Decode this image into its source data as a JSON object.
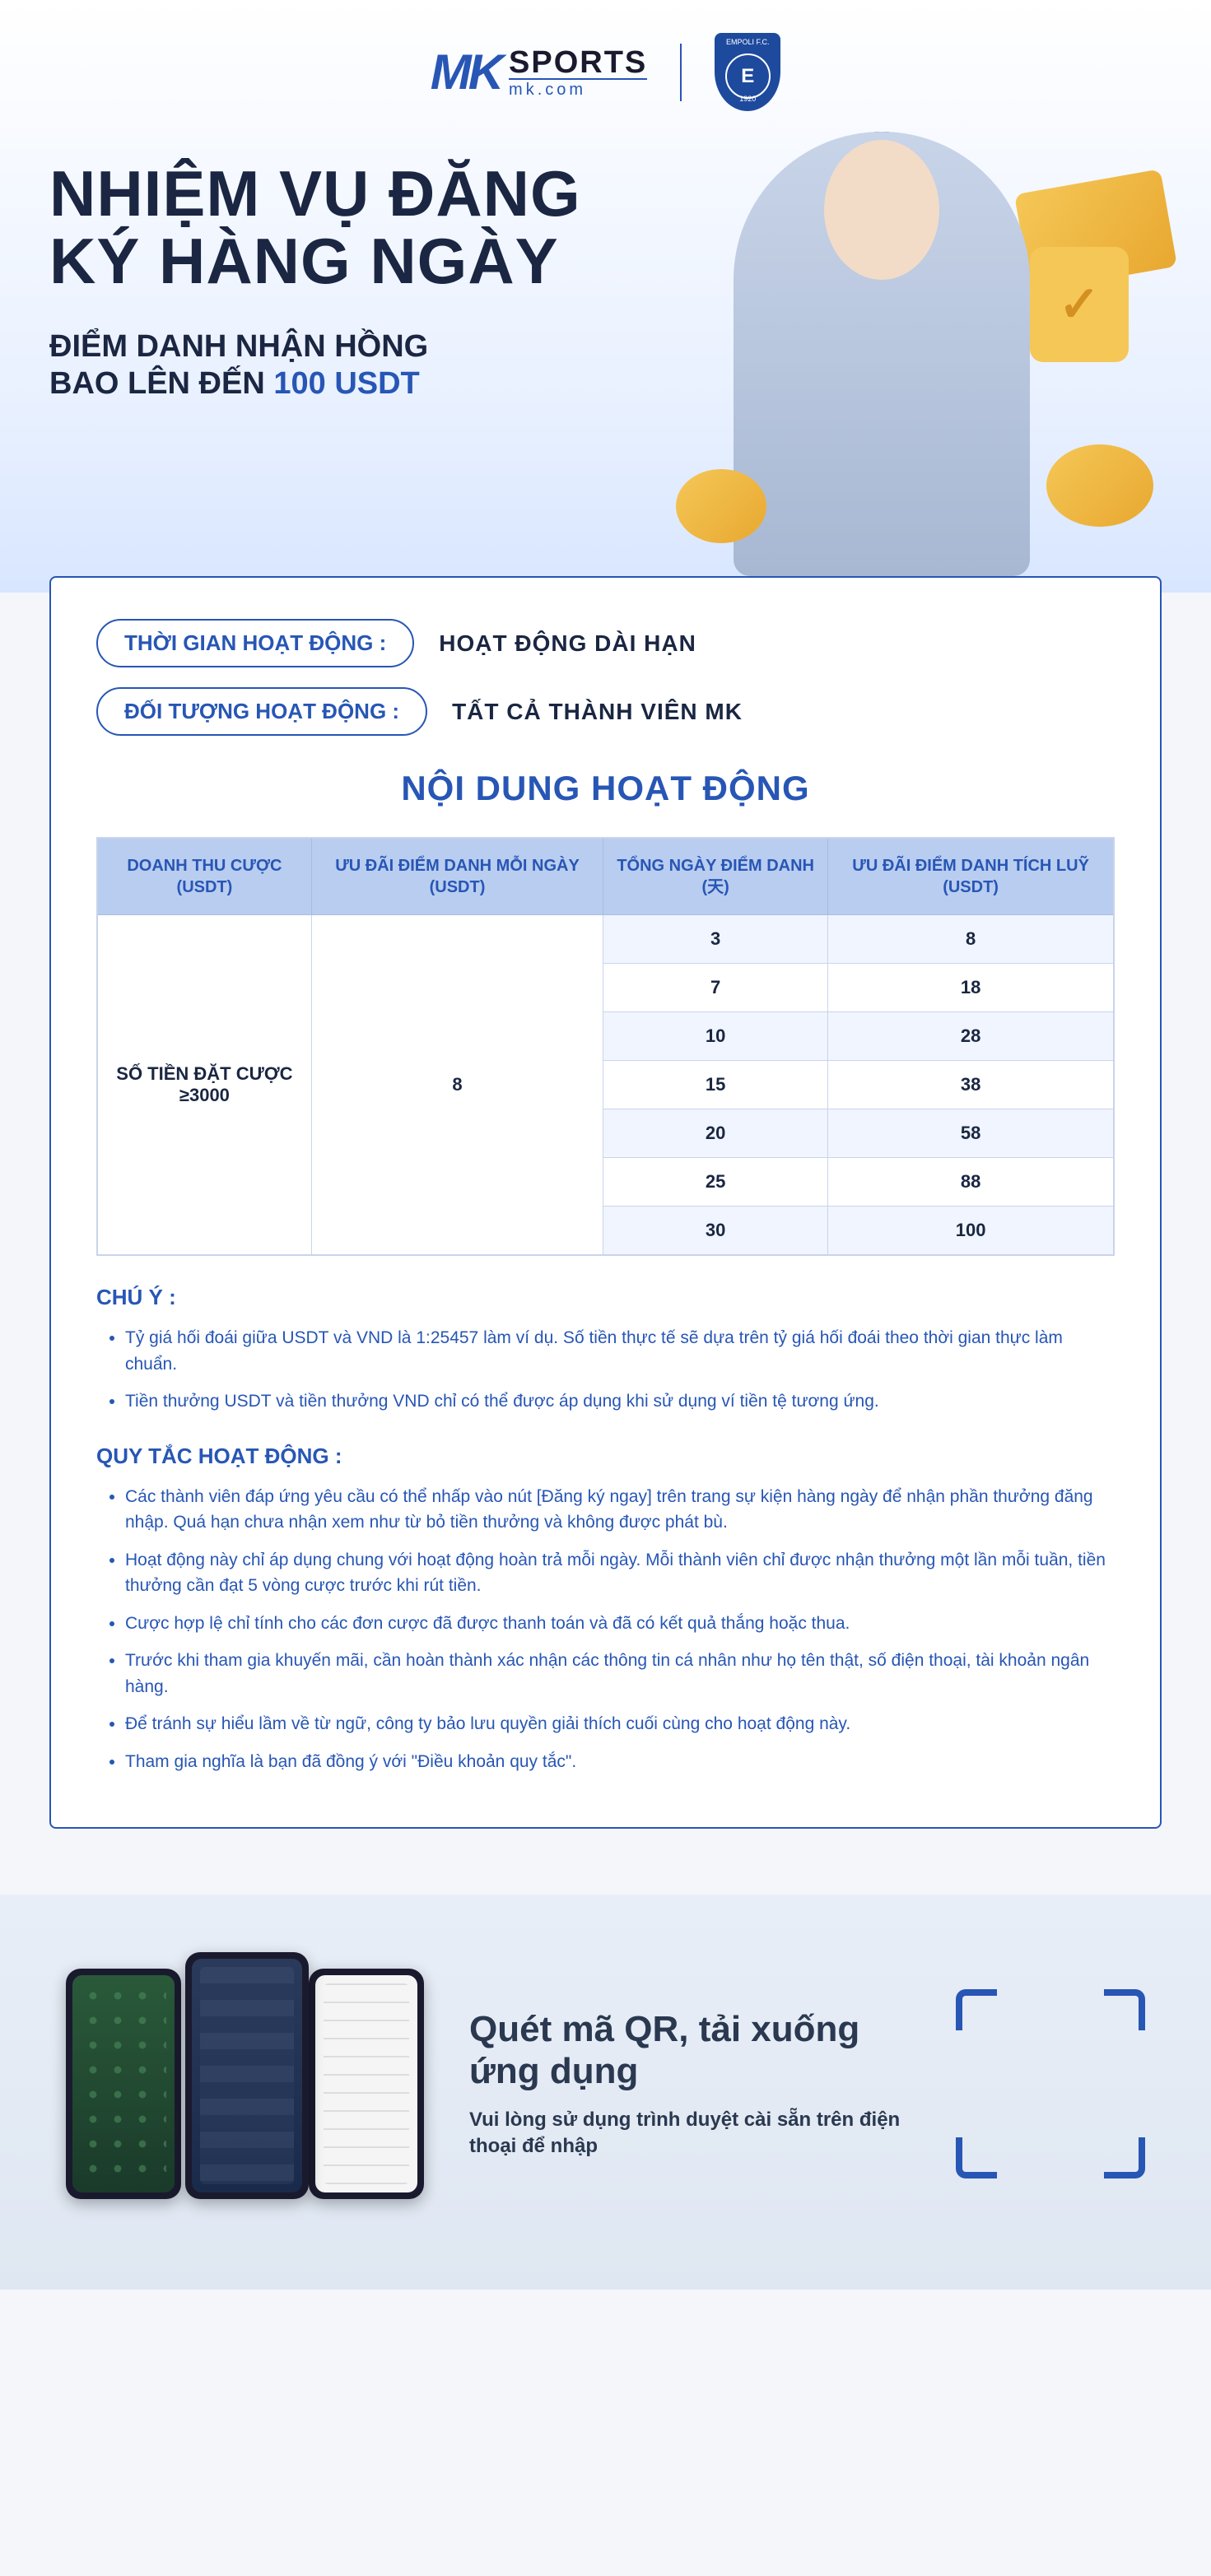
{
  "logo": {
    "brand_prefix": "MK",
    "brand_word": "SPORTS",
    "brand_domain": "mk.com",
    "badge_top": "EMPOLI F.C.",
    "badge_letter": "E",
    "badge_year": "1920"
  },
  "hero": {
    "title_line1": "NHIỆM VỤ ĐĂNG",
    "title_line2": "KÝ HÀNG NGÀY",
    "sub_line1": "ĐIỂM DANH NHẬN HỒNG",
    "sub_line2_pre": "BAO LÊN ĐẾN ",
    "sub_line2_accent": "100 USDT"
  },
  "panel": {
    "row1_label": "THỜI GIAN HOẠT ĐỘNG :",
    "row1_value": "HOẠT ĐỘNG DÀI HẠN",
    "row2_label": "ĐỐI TƯỢNG HOẠT ĐỘNG :",
    "row2_value": "TẤT CẢ THÀNH VIÊN MK",
    "section_title": "NỘI DUNG HOẠT ĐỘNG"
  },
  "table": {
    "headers": [
      "DOANH THU CƯỢC (USDT)",
      "ƯU ĐÃI ĐIỂM DANH MỖI NGÀY (USDT)",
      "TỔNG NGÀY ĐIỂM DANH (天)",
      "ƯU ĐÃI ĐIỂM DANH TÍCH LUỸ (USDT)"
    ],
    "bet_label": "SỐ TIỀN ĐẶT CƯỢC ≥3000",
    "daily_value": "8",
    "rows": [
      {
        "days": "3",
        "accum": "8"
      },
      {
        "days": "7",
        "accum": "18"
      },
      {
        "days": "10",
        "accum": "28"
      },
      {
        "days": "15",
        "accum": "38"
      },
      {
        "days": "20",
        "accum": "58"
      },
      {
        "days": "25",
        "accum": "88"
      },
      {
        "days": "30",
        "accum": "100"
      }
    ]
  },
  "notes": {
    "title": "CHÚ Ý :",
    "items": [
      "Tỷ giá hối đoái giữa USDT và VND là 1:25457 làm ví dụ. Số tiền thực tế sẽ dựa trên tỷ giá hối đoái theo thời gian thực làm chuẩn.",
      "Tiền thưởng USDT và tiền thưởng VND chỉ có thể được áp dụng khi sử dụng ví tiền tệ tương ứng."
    ]
  },
  "rules": {
    "title": "QUY TẮC HOẠT ĐỘNG :",
    "items": [
      "Các thành viên đáp ứng yêu cầu có thể nhấp vào nút [Đăng ký ngay] trên trang sự kiện hàng ngày để nhận phần thưởng đăng nhập. Quá hạn chưa nhận xem như từ bỏ tiền thưởng và không được phát bù.",
      "Hoạt động này chỉ áp dụng chung với hoạt động hoàn trả mỗi ngày. Mỗi thành viên chỉ được nhận thưởng một lần mỗi tuần, tiền thưởng cần đạt 5 vòng cược trước khi rút tiền.",
      "Cược hợp lệ chỉ tính cho các đơn cược đã được thanh toán và đã có kết quả thắng hoặc thua.",
      "Trước khi tham gia khuyến mãi, cần hoàn thành xác nhận các thông tin cá nhân như họ tên thật, số điện thoại, tài khoản ngân hàng.",
      "Để tránh sự hiểu lầm về từ ngữ, công ty bảo lưu quyền giải thích cuối cùng cho hoạt động này.",
      "Tham gia nghĩa là bạn đã đồng ý với \"Điều khoản quy tắc\"."
    ]
  },
  "footer": {
    "title": "Quét mã QR, tải xuống ứng dụng",
    "sub": "Vui lòng sử dụng trình duyệt cài sẵn trên điện thoại để nhập"
  }
}
